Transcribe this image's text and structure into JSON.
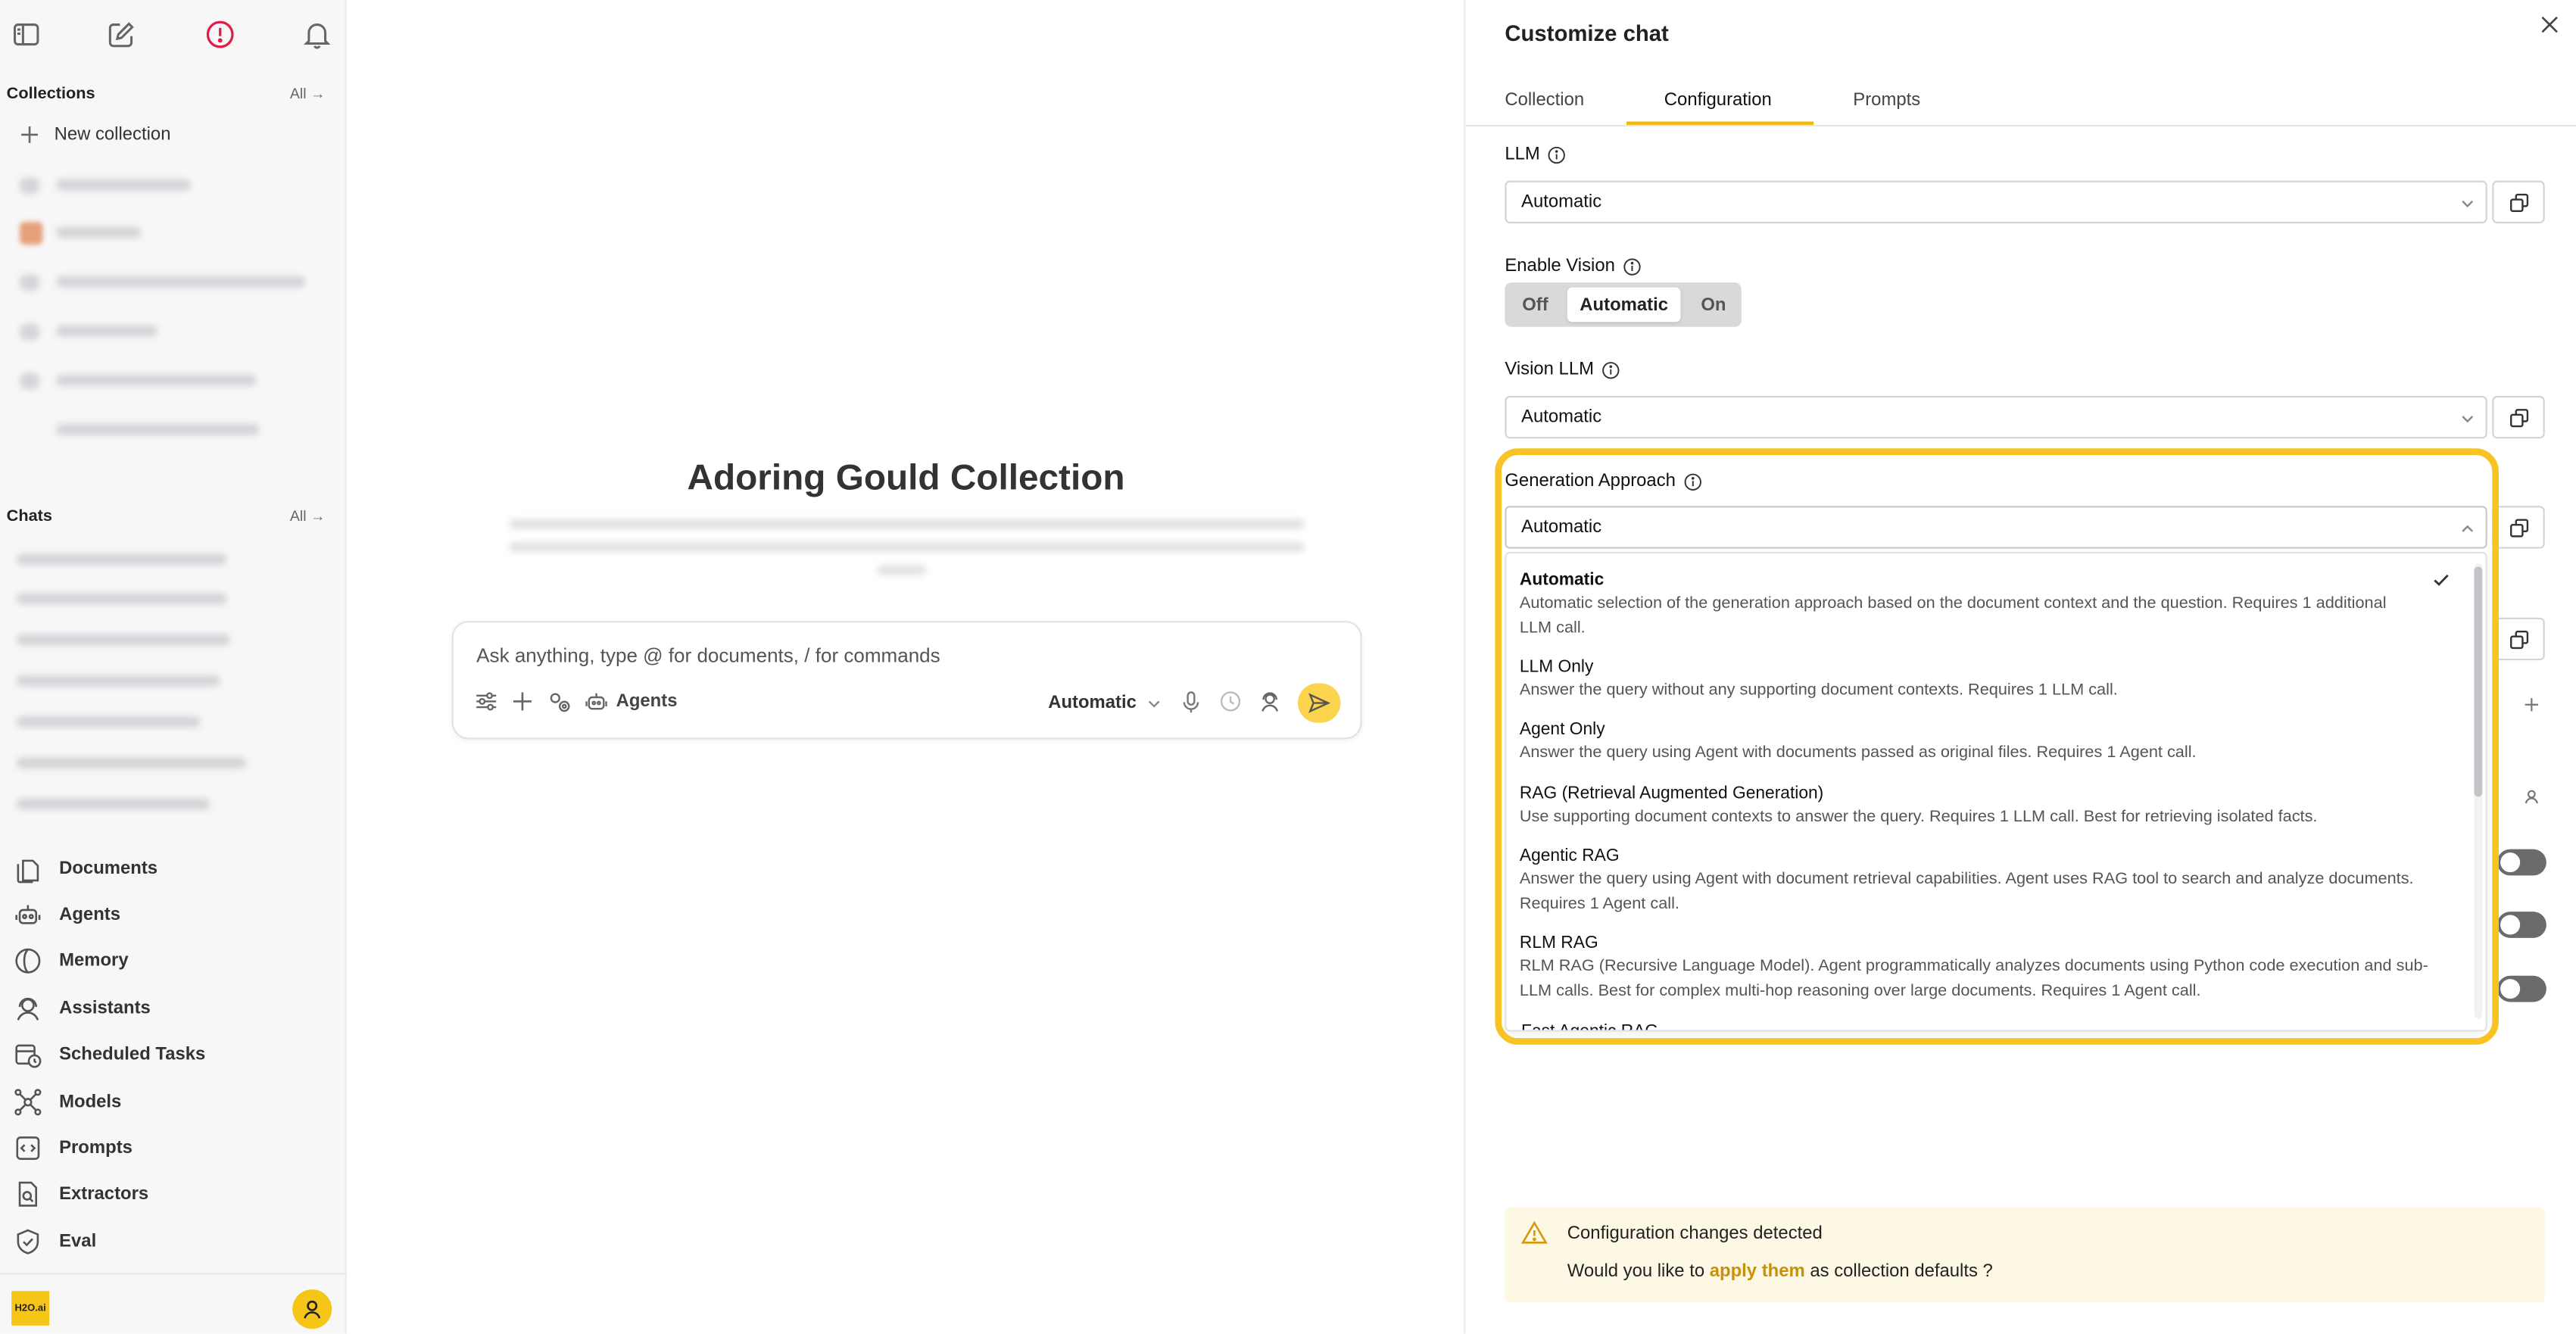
{
  "sidebar": {
    "collections_title": "Collections",
    "collections_all": "All →",
    "new_collection": "New collection",
    "chats_title": "Chats",
    "chats_all": "All →",
    "nav": [
      {
        "label": "Documents",
        "icon": "documents-icon"
      },
      {
        "label": "Agents",
        "icon": "agents-icon"
      },
      {
        "label": "Memory",
        "icon": "memory-icon"
      },
      {
        "label": "Assistants",
        "icon": "assistants-icon"
      },
      {
        "label": "Scheduled Tasks",
        "icon": "calendar-clock-icon"
      },
      {
        "label": "Models",
        "icon": "models-icon"
      },
      {
        "label": "Prompts",
        "icon": "prompts-icon"
      },
      {
        "label": "Extractors",
        "icon": "extractors-icon"
      },
      {
        "label": "Eval",
        "icon": "shield-check-icon"
      }
    ],
    "logo_text": "H2O.ai"
  },
  "main": {
    "collection_title": "Adoring Gould Collection",
    "input_placeholder": "Ask anything, type @ for documents, / for commands",
    "agents_label": "Agents",
    "model_select": "Automatic"
  },
  "panel": {
    "title": "Customize chat",
    "tabs": [
      "Collection",
      "Configuration",
      "Prompts"
    ],
    "active_tab": "Configuration",
    "llm_label": "LLM",
    "llm_value": "Automatic",
    "vision_label": "Enable Vision",
    "vision_options": [
      "Off",
      "Automatic",
      "On"
    ],
    "vision_selected": "Automatic",
    "vision_llm_label": "Vision LLM",
    "vision_llm_value": "Automatic",
    "gen_label": "Generation Approach",
    "gen_value": "Automatic",
    "options": [
      {
        "title": "Automatic",
        "desc": "Automatic selection of the generation approach based on the document context and the question. Requires 1 additional LLM call."
      },
      {
        "title": "LLM Only",
        "desc": "Answer the query without any supporting document contexts. Requires 1 LLM call."
      },
      {
        "title": "Agent Only",
        "desc": "Answer the query using Agent with documents passed as original files. Requires 1 Agent call."
      },
      {
        "title": "RAG (Retrieval Augmented Generation)",
        "desc": "Use supporting document contexts to answer the query. Requires 1 LLM call. Best for retrieving isolated facts."
      },
      {
        "title": "Agentic RAG",
        "desc": "Answer the query using Agent with document retrieval capabilities. Agent uses RAG tool to search and analyze documents. Requires 1 Agent call."
      },
      {
        "title": "RLM RAG",
        "desc": "RLM RAG (Recursive Language Model). Agent programmatically analyzes documents using Python code execution and sub-LLM calls. Best for complex multi-hop reasoning over large documents. Requires 1 Agent call."
      }
    ],
    "banner_title": "Configuration changes detected",
    "banner_text_before": "Would you like to ",
    "banner_link": "apply them",
    "banner_text_after": " as collection defaults ?"
  },
  "colors": {
    "accent": "#f5b800",
    "highlight": "#f7c325",
    "banner_bg": "#fdf8e4",
    "link": "#c9900a",
    "alert_red": "#e11d48"
  }
}
